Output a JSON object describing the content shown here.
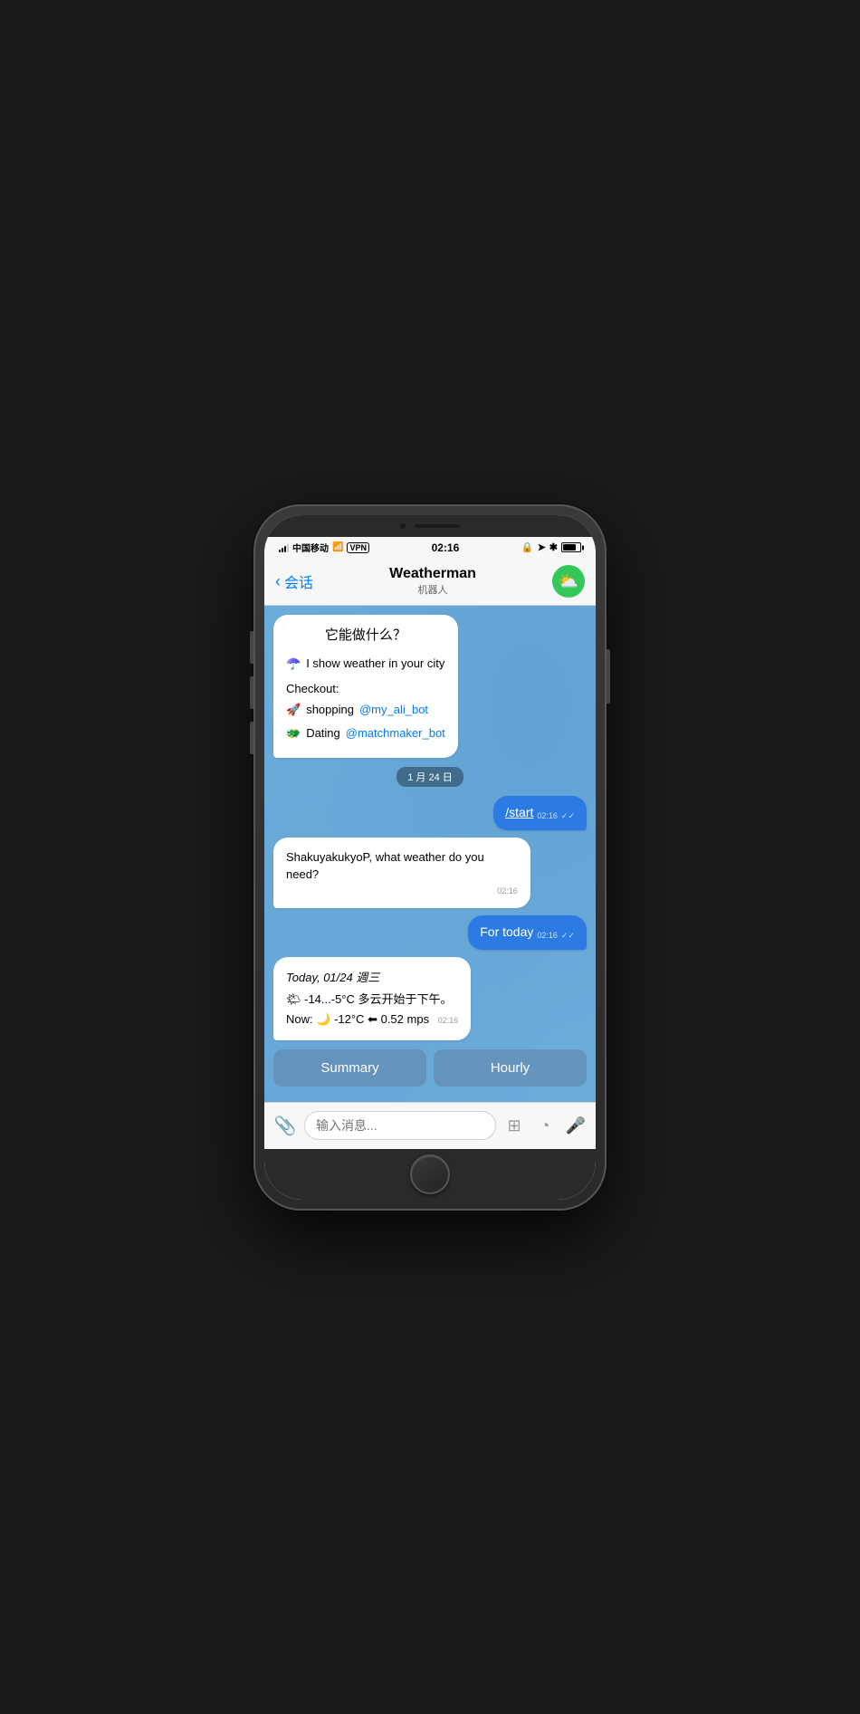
{
  "phone": {
    "status_bar": {
      "carrier": "中国移动",
      "wifi": "WiFi",
      "vpn": "VPN",
      "time": "02:16",
      "battery_pct": 80
    },
    "nav": {
      "back_label": "会话",
      "title": "Weatherman",
      "subtitle": "机器人",
      "avatar_emoji": "⛅"
    },
    "chat": {
      "welcome_title": "它能做什么？",
      "welcome_intro_emoji": "☂️",
      "welcome_intro_text": "I show weather in your city",
      "checkout_label": "Checkout:",
      "checkout_items": [
        {
          "emoji": "🚀",
          "text": "shopping ",
          "link": "@my_ali_bot"
        },
        {
          "emoji": "🐲",
          "text": "Dating ",
          "link": "@matchmaker_bot"
        }
      ],
      "date_divider": "1 月 24 日",
      "outgoing_start": "/start",
      "outgoing_start_time": "02:16",
      "bot_question": "ShakuyakukyoP, what weather do you need?",
      "bot_question_time": "02:16",
      "outgoing_today": "For today",
      "outgoing_today_time": "02:16",
      "weather_date": "Today, 01/24 週三",
      "weather_temp_range": "🌤 -14...-5°C 多云开始于下午。",
      "weather_now_label": "Now:",
      "weather_now_moon": "🌙",
      "weather_now_temp": "-12°C",
      "weather_now_wind_emoji": "⬅",
      "weather_now_wind": "0.52 mps",
      "weather_time": "02:16",
      "btn_summary": "Summary",
      "btn_hourly": "Hourly",
      "input_placeholder": "输入消息..."
    }
  }
}
